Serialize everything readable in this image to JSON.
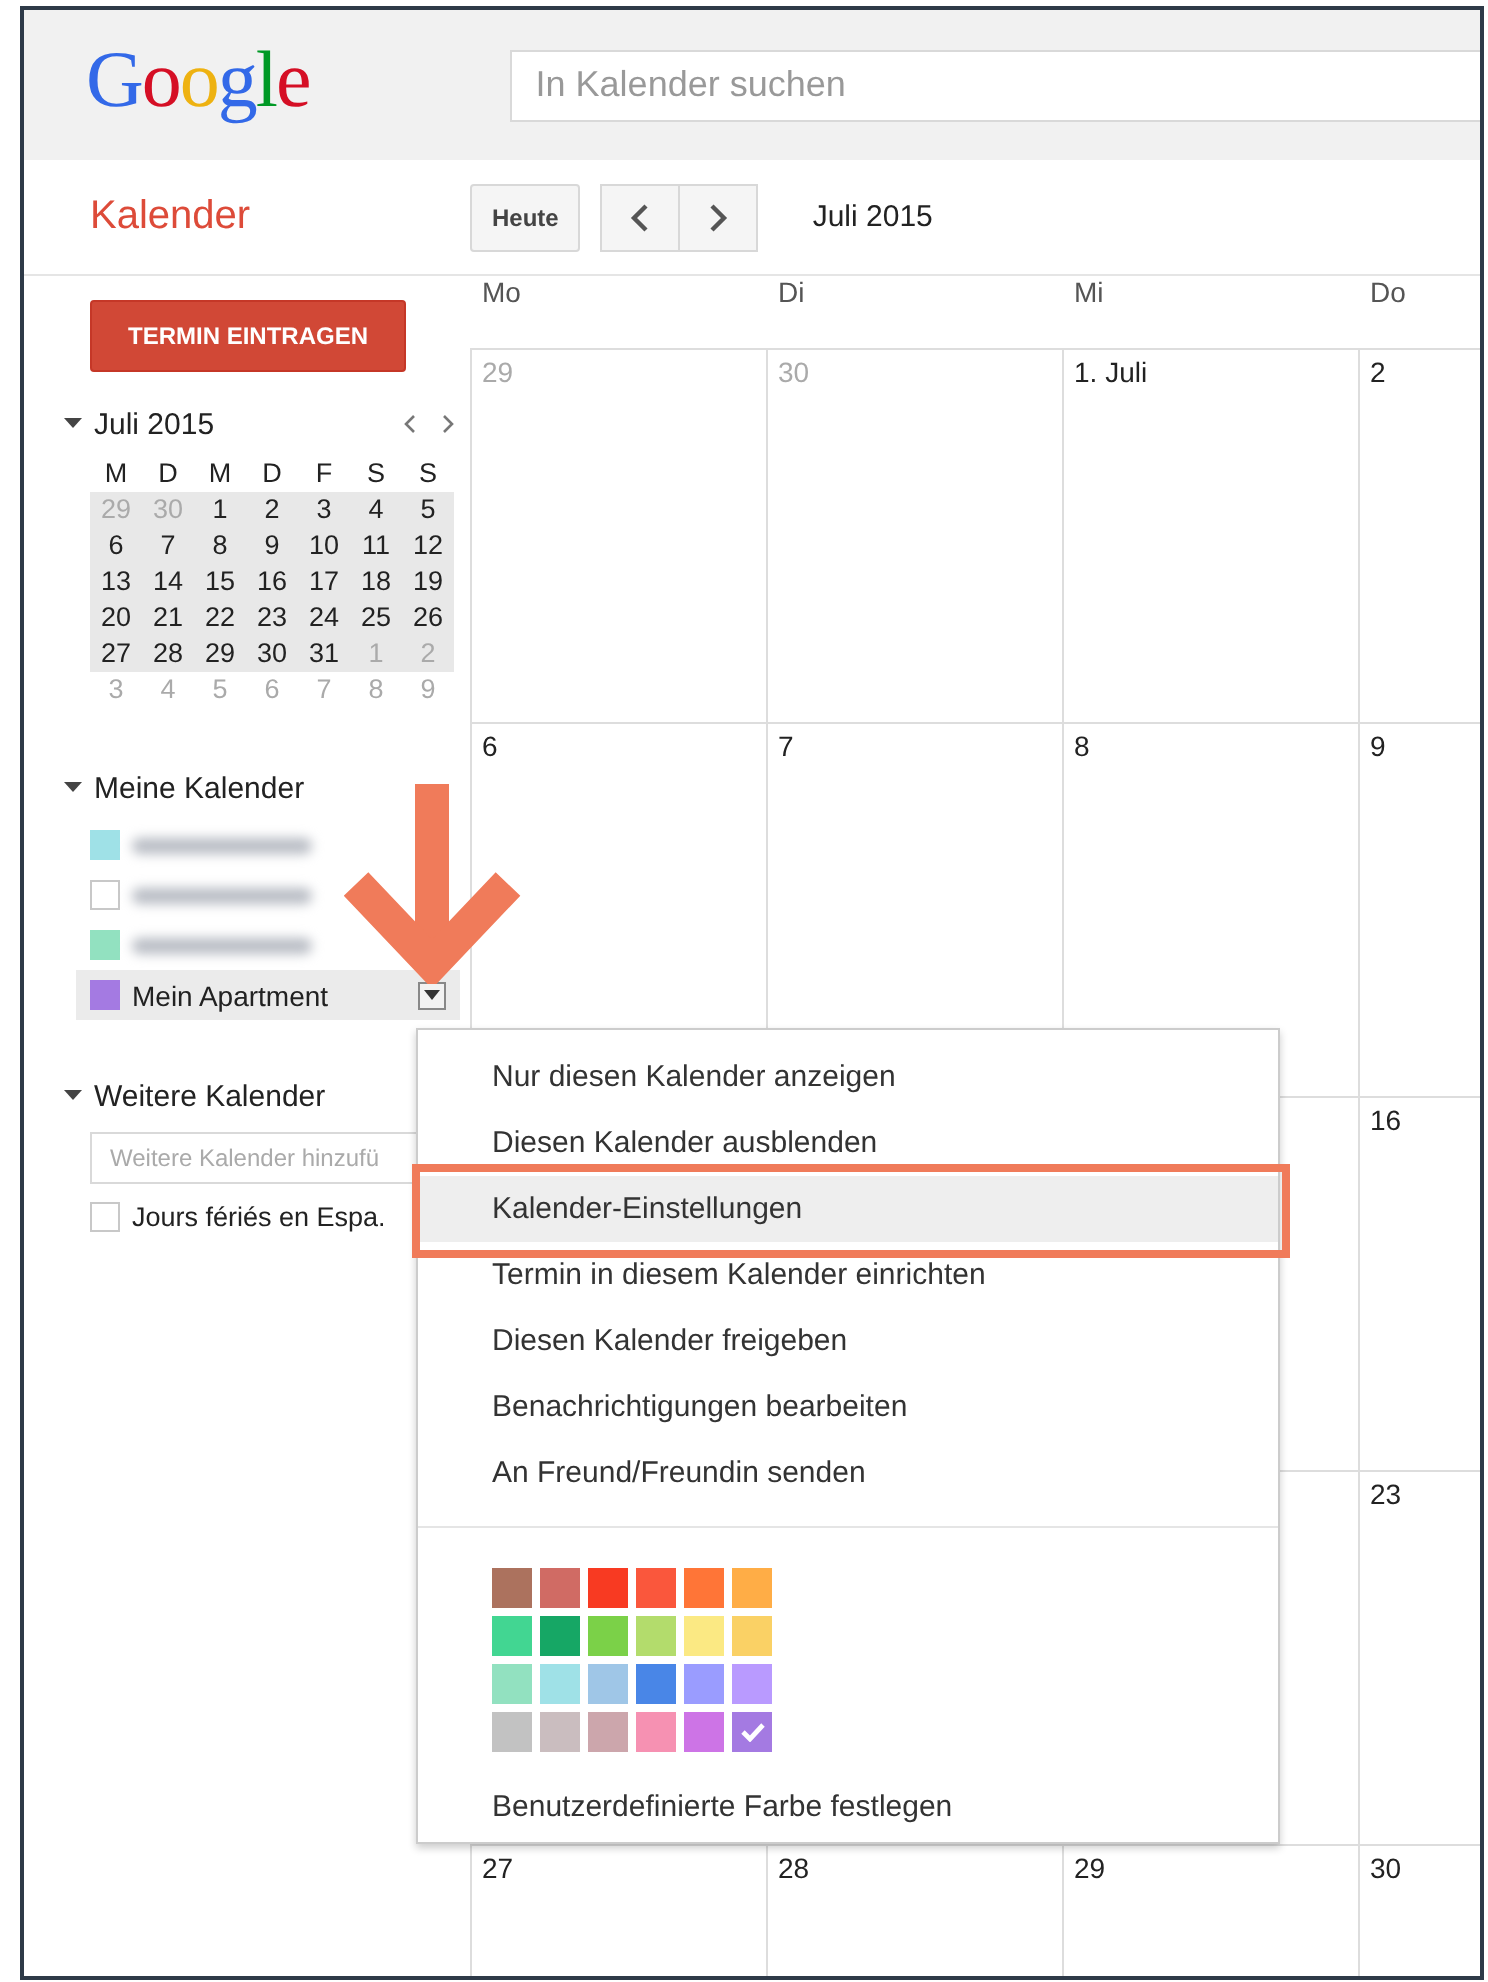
{
  "logo": "Google",
  "search": {
    "placeholder": "In Kalender suchen"
  },
  "app_title": "Kalender",
  "toolbar": {
    "today_button": "Heute",
    "period": "Juli 2015"
  },
  "sidebar": {
    "create_button": "TERMIN EINTRAGEN",
    "mini_calendar": {
      "title": "Juli 2015",
      "expanded": true,
      "weekdays": [
        "M",
        "D",
        "M",
        "D",
        "F",
        "S",
        "S"
      ],
      "weeks": [
        {
          "in_view": true,
          "days": [
            {
              "label": "29",
              "muted": true
            },
            {
              "label": "30",
              "muted": true
            },
            {
              "label": "1",
              "muted": false
            },
            {
              "label": "2",
              "muted": false
            },
            {
              "label": "3",
              "muted": false
            },
            {
              "label": "4",
              "muted": false
            },
            {
              "label": "5",
              "muted": false
            }
          ]
        },
        {
          "in_view": true,
          "days": [
            {
              "label": "6",
              "muted": false
            },
            {
              "label": "7",
              "muted": false
            },
            {
              "label": "8",
              "muted": false
            },
            {
              "label": "9",
              "muted": false
            },
            {
              "label": "10",
              "muted": false
            },
            {
              "label": "11",
              "muted": false
            },
            {
              "label": "12",
              "muted": false
            }
          ]
        },
        {
          "in_view": true,
          "days": [
            {
              "label": "13",
              "muted": false
            },
            {
              "label": "14",
              "muted": false
            },
            {
              "label": "15",
              "muted": false
            },
            {
              "label": "16",
              "muted": false
            },
            {
              "label": "17",
              "muted": false
            },
            {
              "label": "18",
              "muted": false
            },
            {
              "label": "19",
              "muted": false
            }
          ]
        },
        {
          "in_view": true,
          "days": [
            {
              "label": "20",
              "muted": false
            },
            {
              "label": "21",
              "muted": false
            },
            {
              "label": "22",
              "muted": false
            },
            {
              "label": "23",
              "muted": false
            },
            {
              "label": "24",
              "muted": false
            },
            {
              "label": "25",
              "muted": false
            },
            {
              "label": "26",
              "muted": false
            }
          ]
        },
        {
          "in_view": true,
          "days": [
            {
              "label": "27",
              "muted": false
            },
            {
              "label": "28",
              "muted": false
            },
            {
              "label": "29",
              "muted": false
            },
            {
              "label": "30",
              "muted": false
            },
            {
              "label": "31",
              "muted": false
            },
            {
              "label": "1",
              "muted": true
            },
            {
              "label": "2",
              "muted": true
            }
          ]
        },
        {
          "in_view": false,
          "days": [
            {
              "label": "3",
              "muted": true
            },
            {
              "label": "4",
              "muted": true
            },
            {
              "label": "5",
              "muted": true
            },
            {
              "label": "6",
              "muted": true
            },
            {
              "label": "7",
              "muted": true
            },
            {
              "label": "8",
              "muted": true
            },
            {
              "label": "9",
              "muted": true
            }
          ]
        }
      ]
    },
    "my_calendars": {
      "title": "Meine Kalender",
      "expanded": true,
      "items": [
        {
          "blurred": true,
          "checked": true,
          "color": "#9fe1e7",
          "selected": false
        },
        {
          "blurred": true,
          "checked": false,
          "selected": false
        },
        {
          "blurred": true,
          "checked": true,
          "color": "#92e1c0",
          "selected": false
        },
        {
          "name": "Mein Apartment",
          "blurred": false,
          "checked": true,
          "color": "#a47ae2",
          "selected": true
        }
      ]
    },
    "other_calendars": {
      "title": "Weitere Kalender",
      "expanded": true,
      "add_field": {
        "placeholder": "Weitere Kalender hinzufü"
      },
      "items": [
        {
          "name": "Jours fériés en Espa.",
          "checked": false
        }
      ]
    }
  },
  "month": {
    "weekdays": [
      "Mo",
      "Di",
      "Mi",
      "Do"
    ],
    "weeks": [
      [
        {
          "label": "29",
          "muted": true
        },
        {
          "label": "30",
          "muted": true
        },
        {
          "label": "1. Juli",
          "muted": false
        },
        {
          "label": "2",
          "muted": false
        }
      ],
      [
        {
          "label": "6",
          "muted": false
        },
        {
          "label": "7",
          "muted": false
        },
        {
          "label": "8",
          "muted": false
        },
        {
          "label": "9",
          "muted": false
        }
      ],
      [
        {
          "label": "16",
          "muted": false
        }
      ],
      [
        {
          "label": "23",
          "muted": false
        }
      ],
      [
        {
          "label": "27",
          "muted": false
        },
        {
          "label": "28",
          "muted": false
        },
        {
          "label": "29",
          "muted": false
        },
        {
          "label": "30",
          "muted": false
        }
      ]
    ]
  },
  "menu": {
    "items": [
      {
        "label": "Nur diesen Kalender anzeigen",
        "selected": false
      },
      {
        "label": "Diesen Kalender ausblenden",
        "selected": false
      },
      {
        "label": "Kalender-Einstellungen",
        "selected": true
      },
      {
        "label": "Termin in diesem Kalender einrichten",
        "selected": false
      },
      {
        "label": "Diesen Kalender freigeben",
        "selected": false
      },
      {
        "label": "Benachrichtigungen bearbeiten",
        "selected": false
      },
      {
        "label": "An Freund/Freundin senden",
        "selected": false
      }
    ],
    "colors": [
      {
        "color": "#ac725e",
        "selected": false
      },
      {
        "color": "#d06b64",
        "selected": false
      },
      {
        "color": "#f83a22",
        "selected": false
      },
      {
        "color": "#fa573c",
        "selected": false
      },
      {
        "color": "#ff7537",
        "selected": false
      },
      {
        "color": "#ffad46",
        "selected": false
      },
      {
        "color": "#42d692",
        "selected": false
      },
      {
        "color": "#16a765",
        "selected": false
      },
      {
        "color": "#7bd148",
        "selected": false
      },
      {
        "color": "#b3dc6c",
        "selected": false
      },
      {
        "color": "#fbe983",
        "selected": false
      },
      {
        "color": "#fad165",
        "selected": false
      },
      {
        "color": "#92e1c0",
        "selected": false
      },
      {
        "color": "#9fe1e7",
        "selected": false
      },
      {
        "color": "#9fc6e7",
        "selected": false
      },
      {
        "color": "#4986e7",
        "selected": false
      },
      {
        "color": "#9a9cff",
        "selected": false
      },
      {
        "color": "#b99aff",
        "selected": false
      },
      {
        "color": "#c2c2c2",
        "selected": false
      },
      {
        "color": "#cabdbf",
        "selected": false
      },
      {
        "color": "#cca6ac",
        "selected": false
      },
      {
        "color": "#f691b2",
        "selected": false
      },
      {
        "color": "#cd74e6",
        "selected": false
      },
      {
        "color": "#a47ae2",
        "selected": true
      }
    ],
    "custom_color_link": "Benutzerdefinierte Farbe festlegen"
  }
}
